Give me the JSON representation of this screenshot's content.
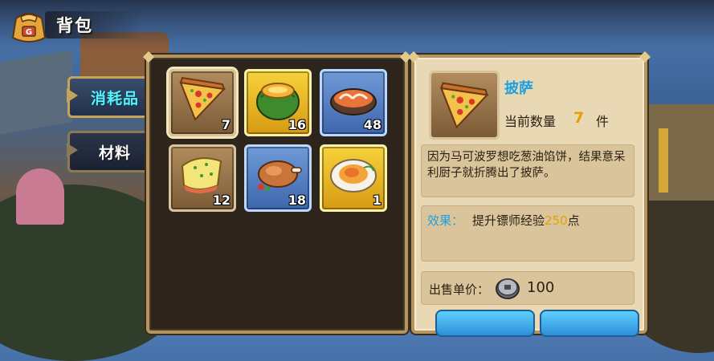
{
  "header": {
    "title": "背包",
    "icon": "bag-icon"
  },
  "tabs": [
    {
      "label": "消耗品",
      "active": true
    },
    {
      "label": "材料",
      "active": false
    }
  ],
  "inventory": {
    "slots": [
      {
        "name": "pizza",
        "count": "7",
        "frame": "brown",
        "selected": true
      },
      {
        "name": "melon-soup",
        "count": "16",
        "frame": "yellow"
      },
      {
        "name": "shrimp-bowl",
        "count": "48",
        "frame": "blue"
      },
      {
        "name": "omelette-roll",
        "count": "12",
        "frame": "brown"
      },
      {
        "name": "roast-chicken",
        "count": "18",
        "frame": "blue"
      },
      {
        "name": "egg-plate",
        "count": "1",
        "frame": "yellow"
      }
    ]
  },
  "detail": {
    "name": "披萨",
    "quantity_label": "当前数量",
    "quantity": "7",
    "quantity_unit": "件",
    "description": "因为马可波罗想吃葱油馅饼，结果意呆利厨子就折腾出了披萨。",
    "effect_label": "效果：",
    "effect_prefix": "提升镖师经验",
    "effect_value": "250",
    "effect_suffix": "点",
    "price_label": "出售单价：",
    "price": "100"
  },
  "colors": {
    "accent_cyan": "#58f0ff",
    "item_name_blue": "#1f9fe0",
    "number_gold": "#e2a300"
  }
}
